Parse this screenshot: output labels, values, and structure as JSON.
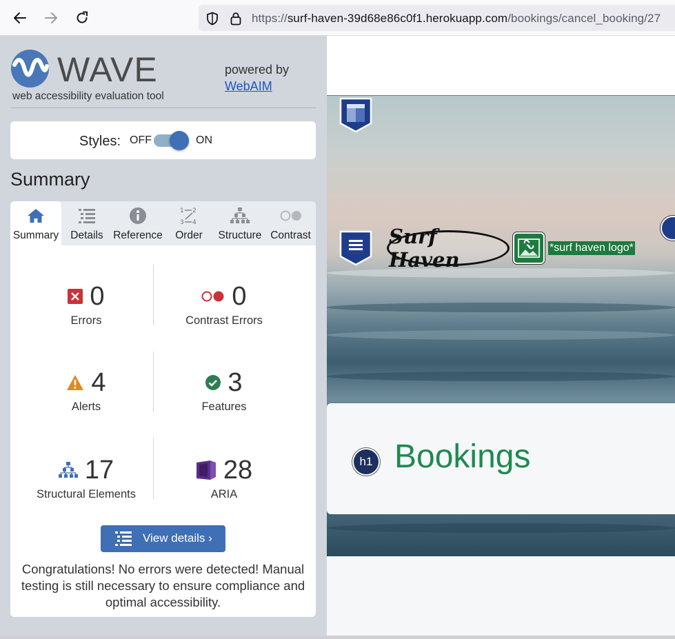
{
  "browser": {
    "url_prefix": "https://",
    "url_host": "surf-haven-39d68e86c0f1.herokuapp.com",
    "url_path": "/bookings/cancel_booking/27"
  },
  "wave": {
    "logo_word": "WAVE",
    "logo_subtitle": "web accessibility evaluation tool",
    "powered_by": "powered by",
    "powered_link": "WebAIM",
    "styles_label": "Styles:",
    "styles_off": "OFF",
    "styles_on": "ON",
    "styles_state": "on",
    "summary_title": "Summary",
    "tabs": [
      {
        "label": "Summary",
        "icon": "home-icon",
        "active": true
      },
      {
        "label": "Details",
        "icon": "list-icon",
        "active": false
      },
      {
        "label": "Reference",
        "icon": "info-icon",
        "active": false
      },
      {
        "label": "Order",
        "icon": "order-icon",
        "active": false
      },
      {
        "label": "Structure",
        "icon": "structure-icon",
        "active": false
      },
      {
        "label": "Contrast",
        "icon": "contrast-icon",
        "active": false
      }
    ],
    "stats": {
      "errors": {
        "value": "0",
        "label": "Errors",
        "color": "#c0392b"
      },
      "contrast_errors": {
        "value": "0",
        "label": "Contrast Errors",
        "color": "#c0392b"
      },
      "alerts": {
        "value": "4",
        "label": "Alerts",
        "color": "#e08a1e"
      },
      "features": {
        "value": "3",
        "label": "Features",
        "color": "#2e7d4f"
      },
      "structural": {
        "value": "17",
        "label": "Structural Elements",
        "color": "#3f6fb5"
      },
      "aria": {
        "value": "28",
        "label": "ARIA",
        "color": "#5b2d8a"
      }
    },
    "view_details": "View details ›",
    "congrats": "Congratulations! No errors were detected! Manual testing is still necessary to ensure compliance and optimal accessibility."
  },
  "page": {
    "logo_text": "Surf Haven",
    "logo_alt": "*surf haven logo*",
    "heading_badge": "h1",
    "heading": "Bookings"
  },
  "colors": {
    "wave_blue": "#3f6fb5",
    "sidebar_bg": "#d1d6dd",
    "heading_green": "#1e8a4f"
  }
}
